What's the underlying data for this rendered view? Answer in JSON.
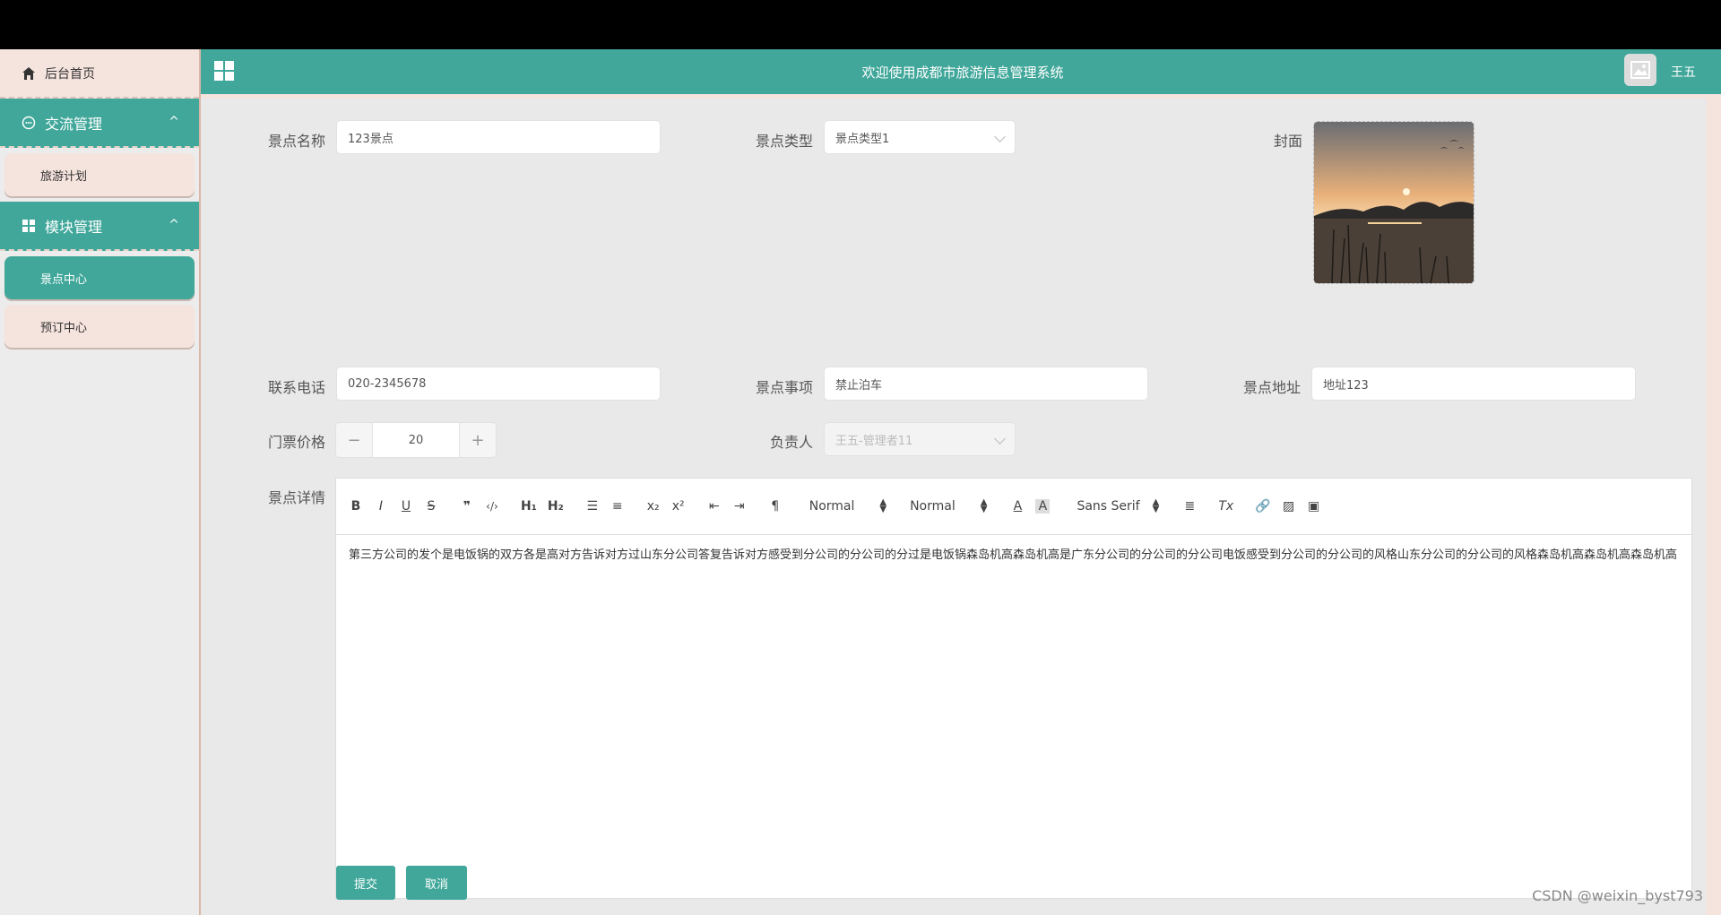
{
  "sidebar": {
    "home": "后台首页",
    "groups": [
      {
        "label": "交流管理",
        "items": [
          "旅游计划"
        ]
      },
      {
        "label": "模块管理",
        "items": [
          "景点中心",
          "预订中心"
        ]
      }
    ]
  },
  "header": {
    "title": "欢迎使用成都市旅游信息管理系统",
    "username": "王五"
  },
  "form": {
    "name": {
      "label": "景点名称",
      "value": "123景点"
    },
    "type": {
      "label": "景点类型",
      "value": "景点类型1"
    },
    "cover": {
      "label": "封面"
    },
    "phone": {
      "label": "联系电话",
      "value": "020-2345678"
    },
    "notice": {
      "label": "景点事项",
      "value": "禁止泊车"
    },
    "address": {
      "label": "景点地址",
      "value": "地址123"
    },
    "price": {
      "label": "门票价格",
      "value": "20"
    },
    "manager": {
      "label": "负责人",
      "value": "王五-管理者11"
    },
    "detail": {
      "label": "景点详情",
      "content": "第三方公司的发个是电饭锅的双方各是高对方告诉对方过山东分公司答复告诉对方感受到分公司的分公司的分过是电饭锅森岛机高森岛机高是广东分公司的分公司的分公司电饭感受到分公司的分公司的风格山东分公司的分公司的风格森岛机高森岛机高森岛机高"
    }
  },
  "editor": {
    "header_select": "Normal",
    "size_select": "Normal",
    "font_select": "Sans Serif"
  },
  "buttons": {
    "submit": "提交",
    "cancel": "取消"
  },
  "watermark": "CSDN @weixin_byst793"
}
